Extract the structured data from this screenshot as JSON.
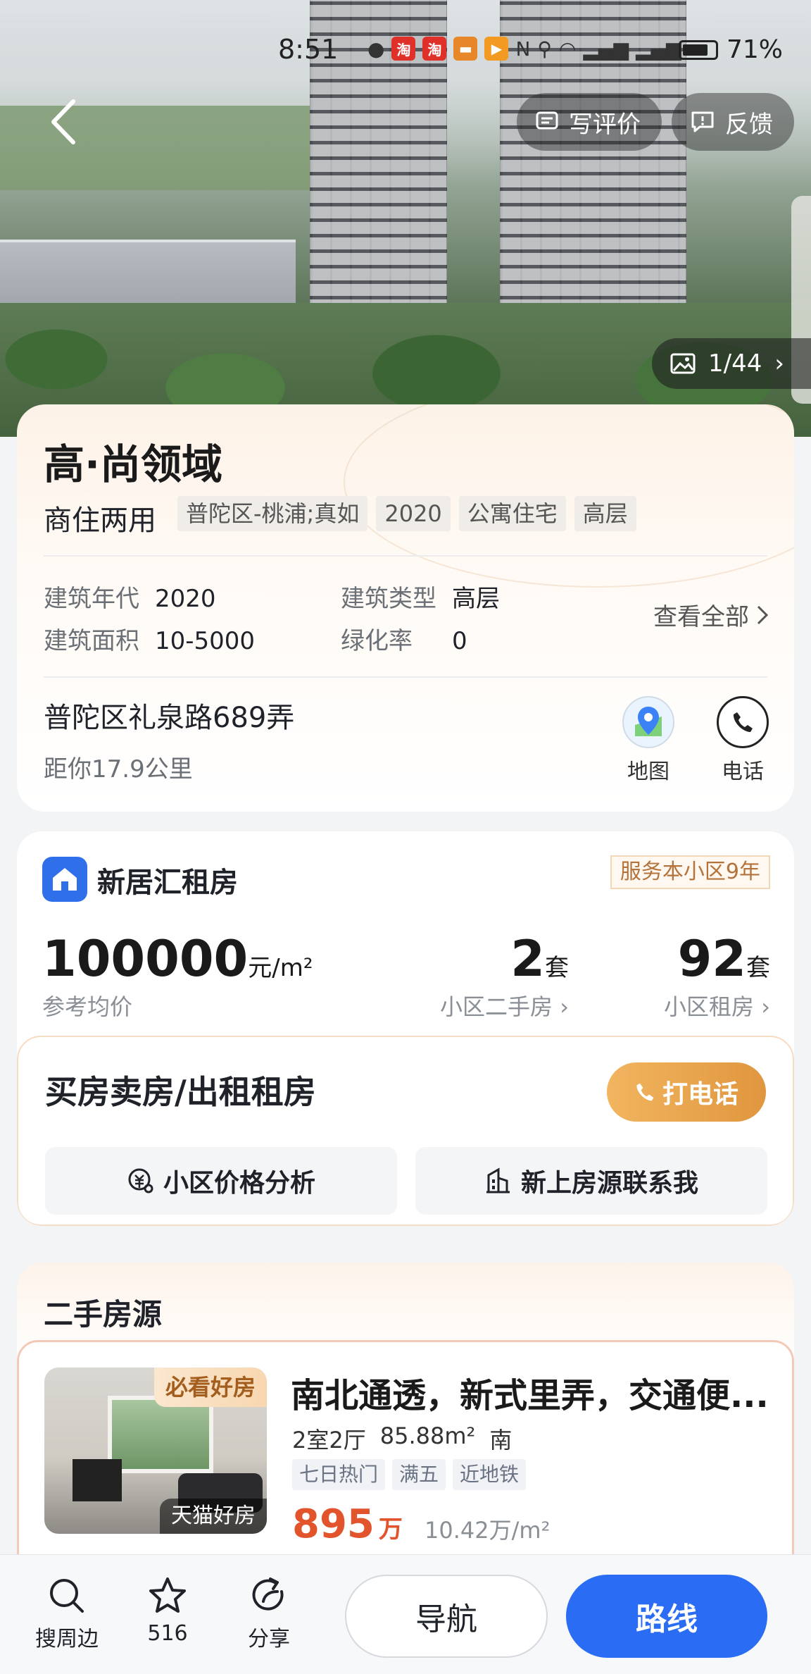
{
  "status_bar": {
    "time": "8:51",
    "battery": "71%",
    "app_icons": [
      "淘",
      "淘",
      "",
      ""
    ],
    "network": "5G 4G"
  },
  "hero": {
    "review_label": "写评价",
    "feedback_label": "反馈",
    "photo_counter": "1/44"
  },
  "project": {
    "name": "高·尚领域",
    "usage": "商住两用",
    "tags": [
      "普陀区-桃浦;真如",
      "2020",
      "公寓住宅",
      "高层"
    ],
    "specs": {
      "build_year_label": "建筑年代",
      "build_year": "2020",
      "build_type_label": "建筑类型",
      "build_type": "高层",
      "area_label": "建筑面积",
      "area": "10-5000",
      "green_label": "绿化率",
      "green": "0"
    },
    "see_all": "查看全部",
    "address": "普陀区礼泉路689弄",
    "distance": "距你17.9公里",
    "map_label": "地图",
    "phone_label": "电话"
  },
  "agent": {
    "name": "新居汇租房",
    "badge": "服务本小区9年",
    "avg_price": "100000",
    "avg_price_unit": "元/m²",
    "avg_price_label": "参考均价",
    "second_hand_count": "2",
    "second_hand_unit": "套",
    "second_hand_label": "小区二手房 ›",
    "rental_count": "92",
    "rental_unit": "套",
    "rental_label": "小区租房 ›",
    "cta_title": "买房卖房/出租租房",
    "call_label": "打电话",
    "price_analysis_label": "小区价格分析",
    "contact_label": "新上房源联系我"
  },
  "listings": {
    "section_title": "二手房源",
    "items": [
      {
        "title": "南北通透，新式里弄，交通便...",
        "layout": "2室2厅",
        "area": "85.88m²",
        "orientation": "南",
        "tags": [
          "七日热门",
          "满五",
          "近地铁"
        ],
        "price": "895",
        "price_unit": "万",
        "unit_price": "10.42万/m²",
        "badge_top": "必看好房",
        "badge_bottom": "天猫好房"
      }
    ]
  },
  "bottom_bar": {
    "search_label": "搜周边",
    "fav_count": "516",
    "share_label": "分享",
    "guide_label": "导航",
    "route_label": "路线"
  },
  "colors": {
    "primary_blue": "#2a6df4",
    "price_red": "#e2542b",
    "call_orange": "#e0963e"
  }
}
